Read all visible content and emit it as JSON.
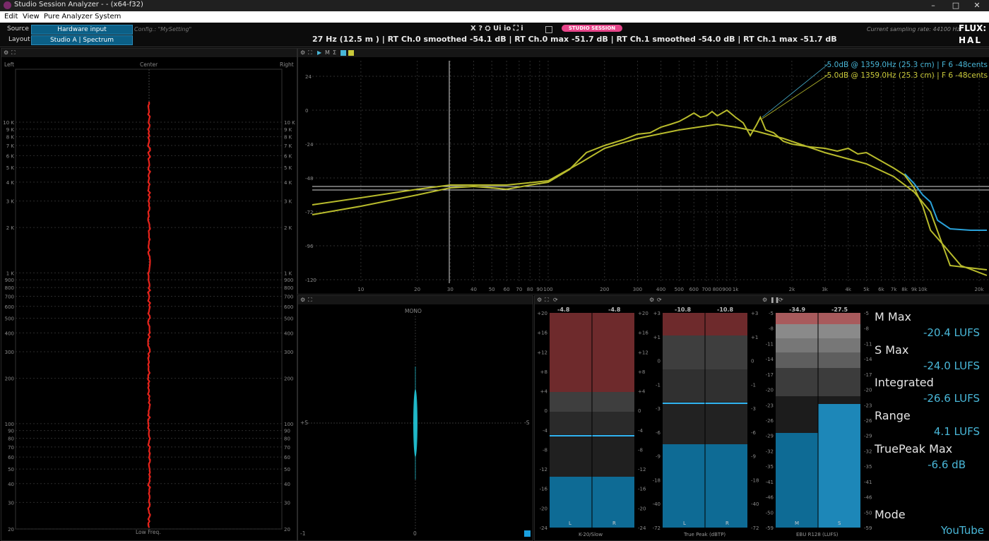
{
  "window": {
    "title": "Studio Session Analyzer -  -  (x64-f32)",
    "minimize": "–",
    "maximize": "□",
    "close": "✕"
  },
  "menu": [
    "Edit",
    "View",
    "Pure Analyzer System"
  ],
  "toolbar": {
    "source_label": "Source",
    "source_value": "Hardware input",
    "layout_label": "Layout",
    "layout_value": "Studio A | Spectrum",
    "config": "Config.: \"MySetting\"",
    "icons": "X  ?  ⛭  Ui  io  ⛶  i",
    "badge": "STUDIO SESSION",
    "info": "27 Hz (12.5 m ) | RT Ch.0  smoothed -54.1 dB | RT Ch.0  max -51.7 dB | RT Ch.1  smoothed -54.0 dB | RT Ch.1  max -51.7 dB",
    "sampling": "Current sampling rate: 44100 Hz",
    "logo_top": "FLUX:",
    "logo_bottom": "HAL"
  },
  "colors": {
    "accent": "#49b7d8",
    "yellow": "#b8bb2c",
    "red": "#e8231b",
    "blue_meter": "#0e6b95",
    "red_zone": "#7a2a2c"
  },
  "vector_panel": {
    "left": "Left",
    "center": "Center",
    "right": "Right",
    "bottom": "Low Freq.",
    "freq_ticks": [
      "10 K",
      "9 K",
      "8 K",
      "7 K",
      "6 K",
      "5 K",
      "4 K",
      "3 K",
      "2 K",
      "1 K",
      "900",
      "800",
      "700",
      "600",
      "500",
      "400",
      "300",
      "200",
      "100",
      "90",
      "80",
      "70",
      "60",
      "50",
      "40",
      "30",
      "20"
    ]
  },
  "spectrum": {
    "annotation_1": "-5.0dB @  1359.0Hz (25.3 cm) |  F 6 -48cents",
    "annotation_2": "-5.0dB @  1359.0Hz (25.3 cm) |  F 6 -48cents",
    "y_ticks": [
      "24",
      "0",
      "-24",
      "-48",
      "-72",
      "-96",
      "-120"
    ],
    "x_ticks": [
      "10",
      "20",
      "30",
      "40",
      "50",
      "60",
      "70",
      "80",
      "90",
      "100",
      "200",
      "300",
      "400",
      "500",
      "600",
      "700",
      "800",
      "900",
      "1k",
      "2k",
      "3k",
      "4k",
      "5k",
      "6k",
      "7k",
      "8k",
      "9k",
      "10k",
      "20k"
    ]
  },
  "stereo_panel": {
    "top": "MONO",
    "left": "+S",
    "right": "-S",
    "bottom_left": "-1",
    "bottom_center": "0"
  },
  "meters": {
    "k20": {
      "label": "K-20/Slow",
      "peak_l": "-4.8",
      "peak_r": "-4.8",
      "ch_l": "L",
      "ch_r": "R",
      "ticks": [
        "+20",
        "+16",
        "+12",
        "+8",
        "+4",
        "0",
        "-4",
        "-8",
        "-12",
        "-16",
        "-20",
        "-24"
      ],
      "fill_db": -13
    },
    "truepeak": {
      "label": "True Peak (dBTP)",
      "peak_l": "-10.8",
      "peak_r": "-10.8",
      "ch_l": "L",
      "ch_r": "R",
      "ticks_l": [
        "+3",
        "+1",
        "0",
        "-1",
        "-3",
        "-6",
        "-9",
        "-18",
        "-40",
        "-72"
      ],
      "ticks_r": [
        "+3",
        "+1",
        "0",
        "-1",
        "-3",
        "-6",
        "-9",
        "-18",
        "-40",
        "-72"
      ]
    },
    "ebu": {
      "label": "EBU R128 (LUFS)",
      "peak_m": "-34.9",
      "peak_s": "-27.5",
      "ch_m": "M",
      "ch_s": "S",
      "ticks_l": [
        "-5",
        "-8",
        "-11",
        "-14",
        "-17",
        "-20",
        "-23",
        "-26",
        "-29",
        "-32",
        "-35",
        "-41",
        "-46",
        "-50",
        "-59"
      ],
      "ticks_r": [
        "-5",
        "-8",
        "-11",
        "-14",
        "-17",
        "-20",
        "-23",
        "-26",
        "-29",
        "-32",
        "-35",
        "-41",
        "-46",
        "-50",
        "-59"
      ]
    }
  },
  "loudness": {
    "m_max_label": "M Max",
    "m_max_value": "-20.4 LUFS",
    "s_max_label": "S Max",
    "s_max_value": "-24.0 LUFS",
    "integrated_label": "Integrated",
    "integrated_value": "-26.6 LUFS",
    "range_label": "Range",
    "range_value": "4.1 LUFS",
    "truepeak_label": "TruePeak Max",
    "truepeak_value": "-6.6 dB",
    "mode_label": "Mode",
    "mode_value": "YouTube"
  }
}
